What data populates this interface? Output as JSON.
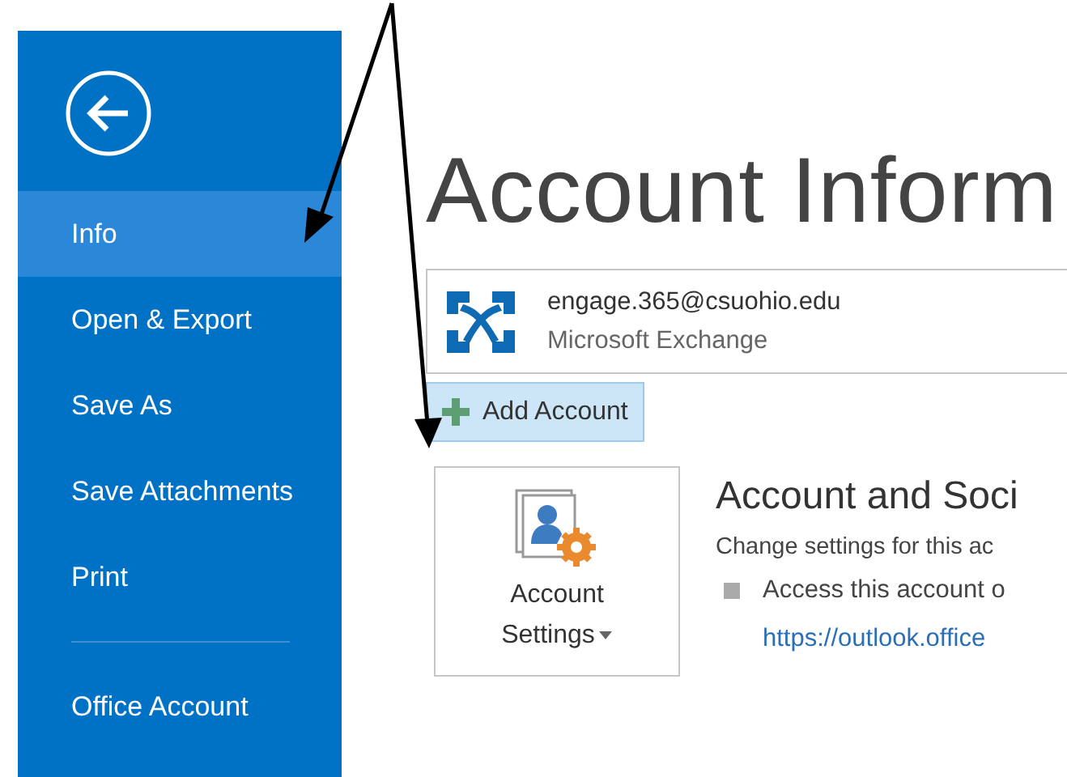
{
  "sidebar": {
    "items": [
      {
        "label": "Info",
        "selected": true
      },
      {
        "label": "Open & Export",
        "selected": false
      },
      {
        "label": "Save As",
        "selected": false
      },
      {
        "label": "Save Attachments",
        "selected": false
      },
      {
        "label": "Print",
        "selected": false
      }
    ],
    "footer_items": [
      {
        "label": "Office Account",
        "selected": false
      }
    ]
  },
  "main": {
    "title": "Account Inform",
    "account": {
      "email": "engage.365@csuohio.edu",
      "type": "Microsoft Exchange"
    },
    "add_account_button": "Add Account",
    "account_settings_button": "Account Settings",
    "section": {
      "heading": "Account and Soci",
      "description": "Change settings for this ac",
      "bullets": [
        {
          "text": "Access this account o",
          "link": "https://outlook.office"
        }
      ]
    }
  }
}
